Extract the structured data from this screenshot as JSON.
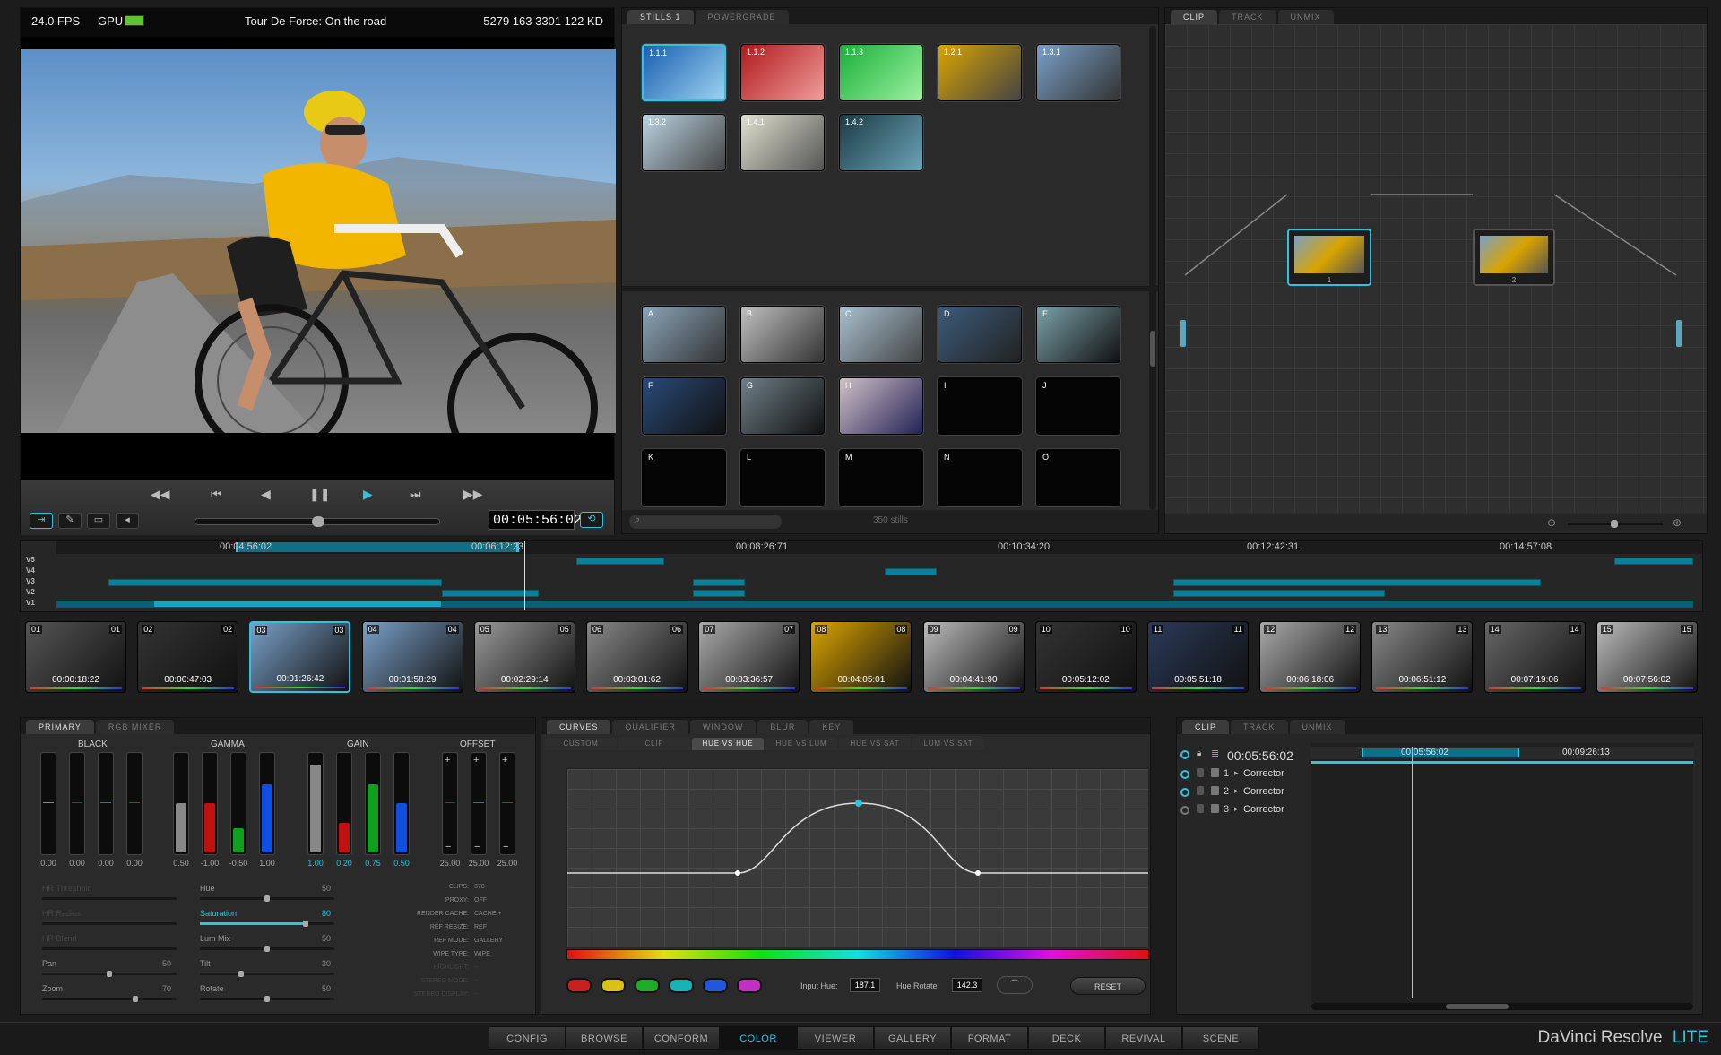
{
  "viewer": {
    "fps": "24.0 FPS",
    "gpu_label": "GPU",
    "title": "Tour De Force: On the road",
    "keycode": "5279 163 3301 122 KD",
    "timecode": "00:05:56:02"
  },
  "gallery": {
    "tabs": [
      "STILLS 1",
      "POWERGRADE"
    ],
    "stills_top": [
      "1.1.1",
      "1.1.2",
      "1.1.3",
      "1.2.1",
      "1.3.1",
      "1.3.2",
      "1.4.1",
      "1.4.2"
    ],
    "stills_bottom": [
      "A",
      "B",
      "C",
      "D",
      "E",
      "F",
      "G",
      "H",
      "I",
      "J",
      "K",
      "L",
      "M",
      "N",
      "O"
    ],
    "count": "350 stills"
  },
  "node_editor": {
    "tabs": [
      "CLIP",
      "TRACK",
      "UNMIX"
    ],
    "nodes": [
      "1",
      "2"
    ]
  },
  "timeline": {
    "ruler": [
      "00:04:56:02",
      "00:06:12:23",
      "00:08:26:71",
      "00:10:34:20",
      "00:12:42:31",
      "00:14:57:08"
    ],
    "tracks": [
      "V5",
      "V4",
      "V3",
      "V2",
      "V1"
    ]
  },
  "clips": [
    {
      "n": "01",
      "tc": "00:00:18:22"
    },
    {
      "n": "02",
      "tc": "00:00:47:03"
    },
    {
      "n": "03",
      "tc": "00:01:26:42"
    },
    {
      "n": "04",
      "tc": "00:01:58:29"
    },
    {
      "n": "05",
      "tc": "00:02:29:14"
    },
    {
      "n": "06",
      "tc": "00:03:01:62"
    },
    {
      "n": "07",
      "tc": "00:03:36:57"
    },
    {
      "n": "08",
      "tc": "00:04:05:01"
    },
    {
      "n": "09",
      "tc": "00:04:41:90"
    },
    {
      "n": "10",
      "tc": "00:05:12:02"
    },
    {
      "n": "11",
      "tc": "00:05:51:18"
    },
    {
      "n": "12",
      "tc": "00:06:18:06"
    },
    {
      "n": "13",
      "tc": "00:06:51:12"
    },
    {
      "n": "14",
      "tc": "00:07:19:06"
    },
    {
      "n": "15",
      "tc": "00:07:56:02"
    }
  ],
  "primary": {
    "tabs": [
      "PRIMARY",
      "RGB MIXER"
    ],
    "groups": {
      "black": "BLACK",
      "gamma": "GAMMA",
      "gain": "GAIN",
      "offset": "OFFSET"
    },
    "black_vals": [
      "0.00",
      "0.00",
      "0.00",
      "0.00"
    ],
    "gamma_vals": [
      "0.50",
      "-1.00",
      "-0.50",
      "1.00"
    ],
    "gain_vals": [
      "1.00",
      "0.20",
      "0.75",
      "0.50"
    ],
    "offset_vals": [
      "25.00",
      "25.00",
      "25.00"
    ],
    "gamma_levels": [
      0.5,
      0.5,
      0.25,
      0.7
    ],
    "gain_levels": [
      0.9,
      0.3,
      0.7,
      0.5
    ],
    "left_params": [
      {
        "label": "HR Threshold",
        "value": ""
      },
      {
        "label": "HR Radius",
        "value": ""
      },
      {
        "label": "HR Blend",
        "value": ""
      },
      {
        "label": "Pan",
        "value": "50"
      },
      {
        "label": "Zoom",
        "value": "70"
      }
    ],
    "mid_params": [
      {
        "label": "Hue",
        "value": "50"
      },
      {
        "label": "Saturation",
        "value": "80"
      },
      {
        "label": "Lum Mix",
        "value": "50"
      },
      {
        "label": "Tilt",
        "value": "30"
      },
      {
        "label": "Rotate",
        "value": "50"
      }
    ],
    "info": [
      {
        "k": "CLIPS:",
        "v": "378"
      },
      {
        "k": "PROXY:",
        "v": "OFF"
      },
      {
        "k": "RENDER CACHE:",
        "v": "CACHE +"
      },
      {
        "k": "REF RESIZE:",
        "v": "REF"
      },
      {
        "k": "REF MODE:",
        "v": "GALLERY"
      },
      {
        "k": "WIPE TYPE:",
        "v": "WIPE"
      },
      {
        "k": "HIGHLIGHT:",
        "v": "--"
      },
      {
        "k": "STEREO MODE:",
        "v": "--"
      },
      {
        "k": "STEREO DISPLAY:",
        "v": "--"
      }
    ]
  },
  "curves": {
    "tabs": [
      "CURVES",
      "QUALIFIER",
      "WINDOW",
      "BLUR",
      "KEY"
    ],
    "subtabs": [
      "CUSTOM",
      "CLIP",
      "HUE VS HUE",
      "HUE VS LUM",
      "HUE VS SAT",
      "LUM VS SAT"
    ],
    "input_hue_label": "Input Hue:",
    "input_hue": "187.1",
    "hue_rotate_label": "Hue Rotate:",
    "hue_rotate": "142.3",
    "reset": "RESET",
    "swatches": [
      "#c62020",
      "#d8c21a",
      "#1faa2a",
      "#19b3b3",
      "#2555d8",
      "#c230c2"
    ]
  },
  "keyframe": {
    "tabs": [
      "CLIP",
      "TRACK",
      "UNMIX"
    ],
    "timecode": "00:05:56:02",
    "ruler": [
      "00:05:56:02",
      "00:09:26:13"
    ],
    "rows": [
      {
        "n": "1",
        "label": "Corrector"
      },
      {
        "n": "2",
        "label": "Corrector"
      },
      {
        "n": "3",
        "label": "Corrector"
      }
    ]
  },
  "nav": {
    "items": [
      "CONFIG",
      "BROWSE",
      "CONFORM",
      "COLOR",
      "VIEWER",
      "GALLERY",
      "FORMAT",
      "DECK",
      "REVIVAL",
      "SCENE"
    ],
    "active": "COLOR"
  },
  "brand": {
    "name": "DaVinci Resolve",
    "edition": "LITE"
  }
}
